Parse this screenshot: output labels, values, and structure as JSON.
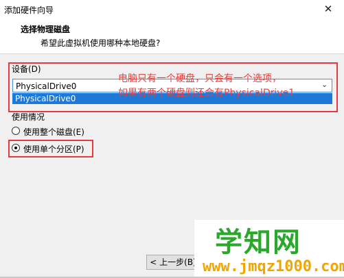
{
  "window": {
    "title": "添加硬件向导",
    "close_glyph": "✕"
  },
  "header": {
    "title": "选择物理磁盘",
    "subtitle": "希望此虚拟机使用哪种本地硬盘?"
  },
  "device": {
    "label": "设备(D)",
    "selected": "PhysicalDrive0",
    "options": [
      "PhysicalDrive0"
    ]
  },
  "usage": {
    "label": "使用情况",
    "options": [
      {
        "label": "使用整个磁盘(E)",
        "checked": false
      },
      {
        "label": "使用单个分区(P)",
        "checked": true
      }
    ]
  },
  "annotation": {
    "line1": "电脑只有一个硬盘，只会有一个选项，",
    "line2": "如果有两个硬盘则还会有PhysicalDrive1",
    "color": "#e83a3a"
  },
  "buttons": {
    "back": "< 上一步(B)"
  },
  "watermark": {
    "main": "学知网",
    "url": "www.jmqz1000.com"
  },
  "icons": {
    "close": "close-icon",
    "dropdown": "chevron-down-icon"
  }
}
